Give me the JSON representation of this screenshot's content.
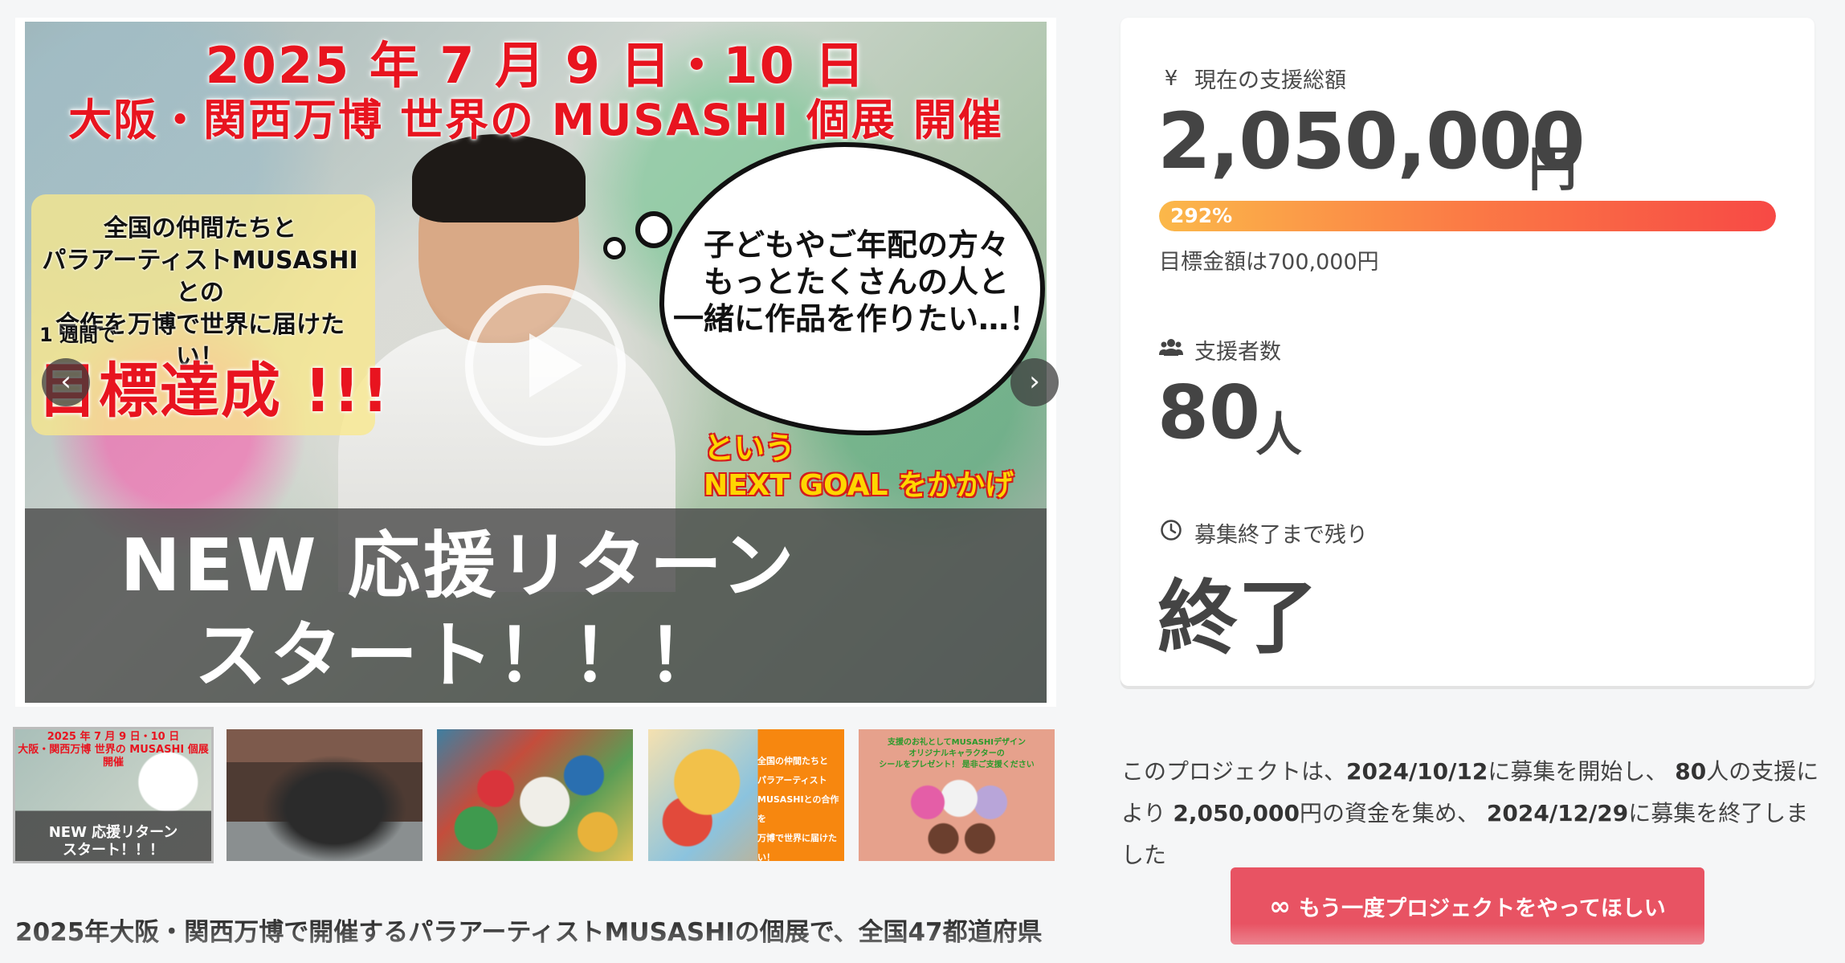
{
  "hero": {
    "title_line1": "2025 年 7 月 9 日・10 日",
    "title_line2": "大阪・関西万博 世界の MUSASHI 個展 開催",
    "left_box_text": "全国の仲間たちと\nパラアーティストMUSASHIとの\n合作を万博で世界に届けたい！",
    "week_text": "1 週間で",
    "achieved_text": "目標達成 !!!",
    "thought_text": "子どもやご年配の方々\nもっとたくさんの人と\n一緒に作品を作りたい…！",
    "next_goal_line1": "という",
    "next_goal_line2": "NEXT GOAL をかかげ",
    "bottom_text": "NEW 応援リターン\nスタート！！！",
    "arrow_left": "‹",
    "arrow_right": "›"
  },
  "thumbnails": [
    {
      "title": "2025 年 7 月 9 日・10 日\n大阪・関西万博 世界の MUSASHI 個展 開催",
      "bottom": "NEW 応援リターン\nスタート！！！"
    },
    {},
    {},
    {
      "text": "全国の仲間たちと\nパラアーティスト\nMUSASHIとの合作を\n万博で世界に届けたい！"
    },
    {
      "text": "支援のお礼としてMUSASHIデザイン\nオリジナルキャラクターの\nシールをプレゼント！ 是非ご支援ください"
    }
  ],
  "description": {
    "line1": "2025年大阪・関西万博で開催するパラアーティストMUSASHIの個展で、全国47都道府県",
    "line2": ""
  },
  "stats": {
    "amount_label": "現在の支援総額",
    "amount_icon": "yen-icon",
    "amount_value": "2,050,000",
    "amount_unit": "円",
    "progress_percent_text": "292%",
    "progress_value": 292,
    "goal_text": "目標金額は700,000円",
    "backers_label": "支援者数",
    "backers_icon": "users-icon",
    "backers_value": "80",
    "backers_unit": "人",
    "remaining_label": "募集終了まで残り",
    "remaining_icon": "clock-icon",
    "remaining_value": "終了"
  },
  "summary": {
    "part1": "このプロジェクトは、",
    "start_date": "2024/10/12",
    "part2": "に募集を開始し、 ",
    "backers": "80",
    "part3": "人の支援により ",
    "amount": "2,050,000",
    "part4": "円の資金を集め、 ",
    "end_date": "2024/12/29",
    "part5": "に募集を終了しました"
  },
  "cta": {
    "icon": "infinity-icon",
    "label": "もう一度プロジェクトをやってほしい"
  },
  "colors": {
    "accent_red": "#e85363",
    "progress_start": "#fbb84a",
    "progress_end": "#f74945",
    "hero_red": "#e8141f",
    "next_goal_yellow": "#ffd600"
  }
}
